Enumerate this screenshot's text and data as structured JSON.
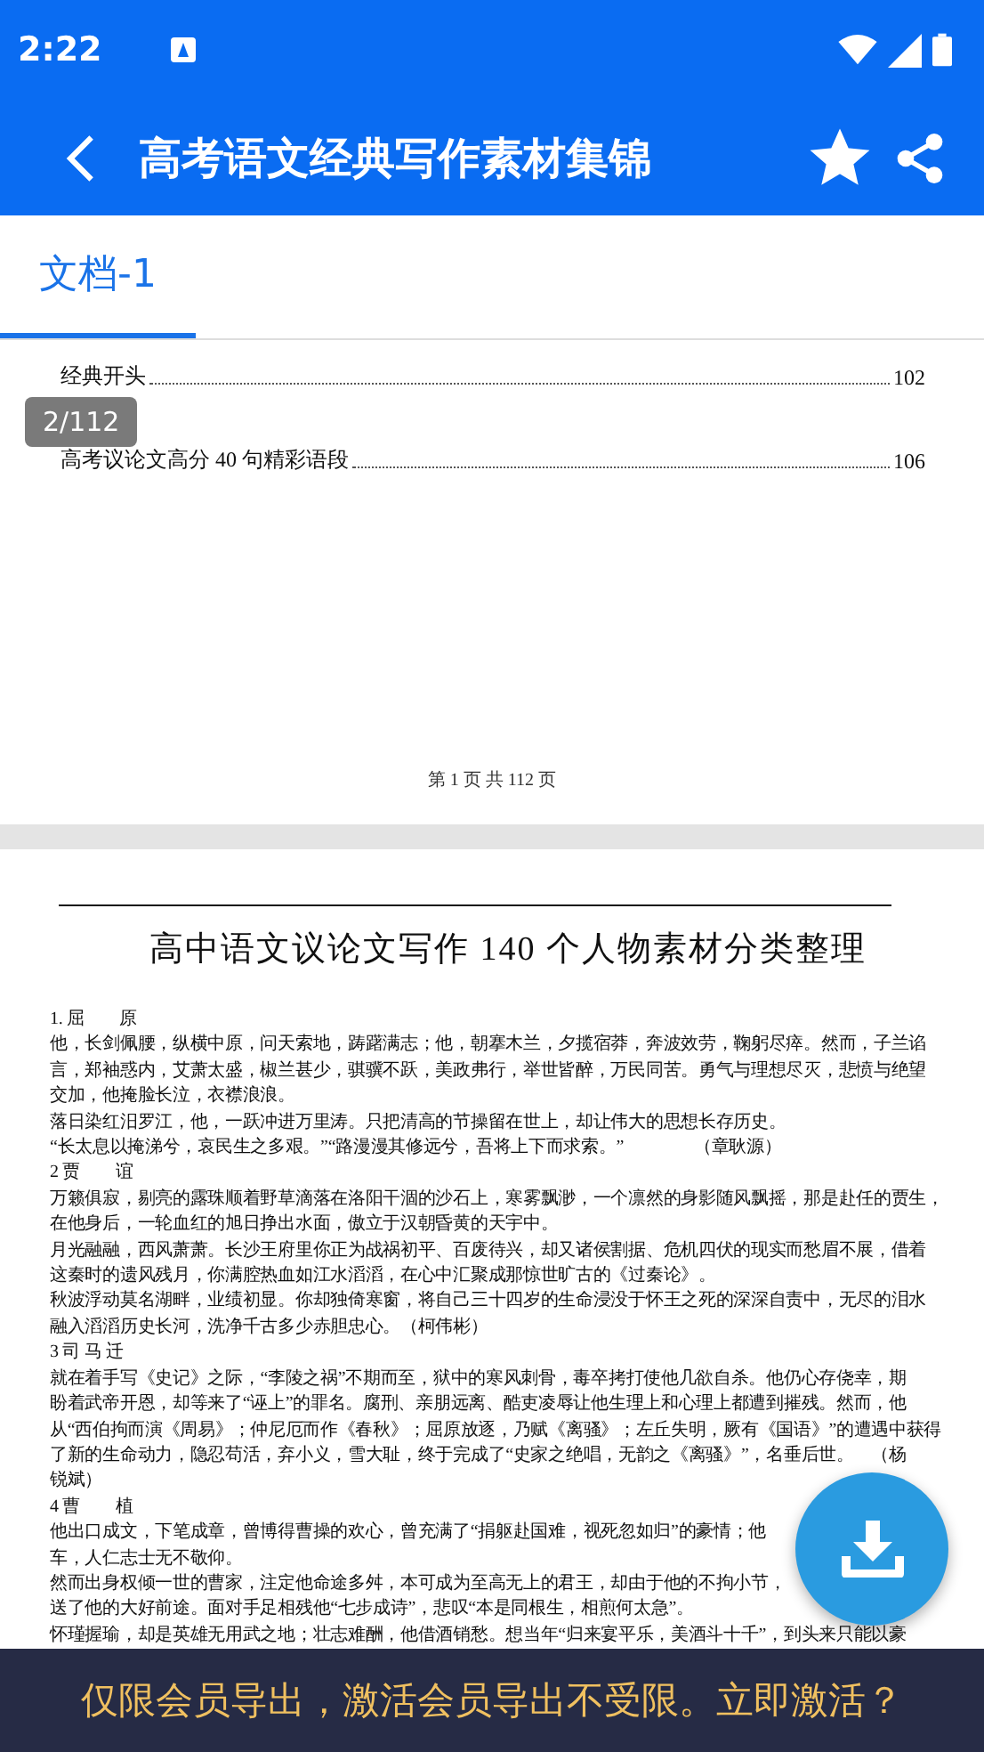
{
  "status_bar": {
    "time": "2:22"
  },
  "app_bar": {
    "title": "高考语文经典写作素材集锦",
    "favorite": true
  },
  "tabs": [
    {
      "label": "文档-1",
      "selected": true
    }
  ],
  "page_badge": "2/112",
  "pages": [
    {
      "kind": "toc",
      "entries": [
        {
          "title": "经典开头",
          "page": "102"
        },
        {
          "title": "高考议论文高分 40 句精彩语段",
          "page": "106"
        }
      ],
      "footer": "第 1 页 共 112 页"
    },
    {
      "kind": "text",
      "title": "高中语文议论文写作 140 个人物素材分类整理",
      "lines": [
        "1. 屈　　原",
        "他，长剑佩腰，纵横中原，问天索地，踌躇满志；他，朝搴木兰，夕揽宿莽，奔波效劳，鞠躬尽瘁。然而，子兰谄",
        "言，郑袖惑内，艾萧太盛，椒兰甚少，骐骥不跃，美政弗行，举世皆醉，万民同苦。勇气与理想尽灭，悲愤与绝望",
        "交加，他掩脸长泣，衣襟浪浪。",
        "落日染红汨罗江，他，一跃冲进万里涛。只把清高的节操留在世上，却让伟大的思想长存历史。",
        "“长太息以掩涕兮，哀民生之多艰。”“路漫漫其修远兮，吾将上下而求索。”　　　　（章耿源）",
        "2 贾　　谊",
        "万籁俱寂，剔亮的露珠顺着野草滴落在洛阳干涸的沙石上，寒雾飘渺，一个凛然的身影随风飘摇，那是赴任的贾生，",
        "在他身后，一轮血红的旭日挣出水面，傲立于汉朝昏黄的天宇中。",
        "月光融融，西风萧萧。长沙王府里你正为战祸初平、百废待兴，却又诸侯割据、危机四伏的现实而愁眉不展，借着",
        "这秦时的遗风残月，你满腔热血如江水滔滔，在心中汇聚成那惊世旷古的《过秦论》。",
        "秋波浮动莫名湖畔，业绩初显。你却独倚寒窗，将自己三十四岁的生命浸没于怀王之死的深深自责中，无尽的泪水",
        "融入滔滔历史长河，洗净千古多少赤胆忠心。（柯伟彬）",
        "3 司 马 迁",
        "就在着手写《史记》之际，“李陵之祸”不期而至，狱中的寒风刺骨，毒卒拷打使他几欲自杀。他仍心存侥幸，期",
        "盼着武帝开恩，却等来了“诬上”的罪名。腐刑、亲朋远离、酷吏凌辱让他生理上和心理上都遭到摧残。然而，他",
        "从“西伯拘而演《周易》；仲尼厄而作《春秋》；屈原放逐，乃赋《离骚》；左丘失明，厥有《国语》”的遭遇中获得",
        "了新的生命动力，隐忍苟活，弃小义，雪大耻，终于完成了“史家之绝唱，无韵之《离骚》”，名垂后世。　（杨",
        "锐斌）",
        "4 曹　　植",
        "他出口成文，下笔成章，曾博得曹操的欢心，曾充满了“捐躯赴国难，视死忽如归”的豪情；他",
        "车，人仁志士无不敬仰。",
        "然而出身权倾一世的曹家，注定他命途多舛，本可成为至高无上的君王，却由于他的不拘小节，",
        "送了他的大好前途。面对手足相残他“七步成诗”，悲叹“本是同根生，相煎何太急”。",
        "怀瑾握瑜，却是英雄无用武之地；壮志难酬，他借酒销愁。想当年“归来宴平乐，美酒斗十千”，到头来只能以豪"
      ]
    }
  ],
  "export_banner": "仅限会员导出，激活会员导出不受限。立即激活？"
}
